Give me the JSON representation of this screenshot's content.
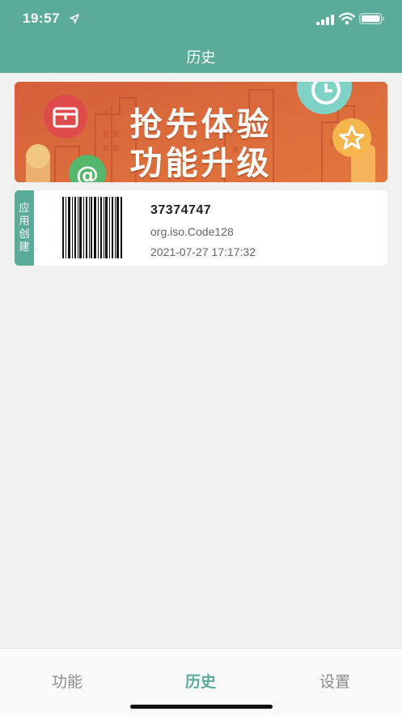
{
  "status_bar": {
    "time": "19:57",
    "icons": [
      "location-arrow-icon",
      "signal-icon",
      "wifi-icon",
      "battery-icon"
    ]
  },
  "nav": {
    "title": "历史"
  },
  "banner": {
    "line1": "抢先体验",
    "line2": "功能升级"
  },
  "history": [
    {
      "tag": "应用创建",
      "value": "37374747",
      "type": "org.iso.Code128",
      "time": "2021-07-27 17:17:32"
    }
  ],
  "tabs": [
    {
      "label": "功能",
      "active": false
    },
    {
      "label": "历史",
      "active": true
    },
    {
      "label": "设置",
      "active": false
    }
  ],
  "colors": {
    "accent": "#5aab98",
    "banner": "#dc6a3a",
    "background": "#f1f1f1"
  }
}
